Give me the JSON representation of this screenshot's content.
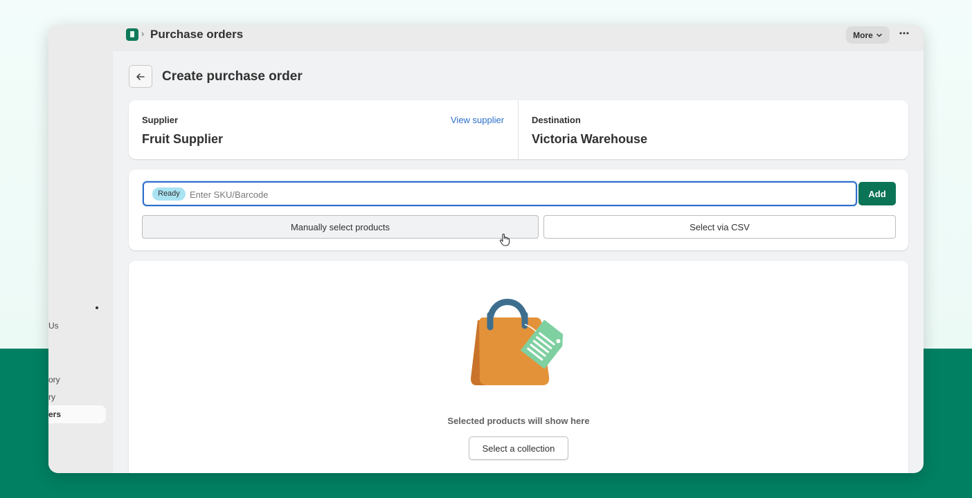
{
  "topbar": {
    "breadcrumb_separator": "›",
    "title": "Purchase orders",
    "more_label": "More",
    "more_chevron": "⌄",
    "overflow_glyph": "•••",
    "app_icon": "clipboard-icon"
  },
  "sidebar": {
    "items": [
      {
        "label": "Us"
      },
      {
        "label": "ory"
      },
      {
        "label": "ry"
      },
      {
        "label": "ers",
        "active": true
      }
    ]
  },
  "page": {
    "back_icon": "arrow-left-icon",
    "title": "Create purchase order"
  },
  "supplier": {
    "label": "Supplier",
    "name": "Fruit Supplier",
    "link": "View supplier"
  },
  "destination": {
    "label": "Destination",
    "name": "Victoria Warehouse"
  },
  "scanner": {
    "badge": "Ready",
    "placeholder": "Enter SKU/Barcode",
    "value": "",
    "add_label": "Add",
    "manual_label": "Manually select products",
    "csv_label": "Select via CSV"
  },
  "empty_state": {
    "illustration": "shopping-bag-icon",
    "message": "Selected products will show here",
    "button_label": "Select a collection"
  },
  "colors": {
    "brand_green": "#0b7356",
    "background_green": "#018062",
    "link_blue": "#2c6ecb",
    "badge_blue": "#a9e3f2",
    "bag_orange": "#e3923a",
    "tag_green": "#7fd0a0",
    "handle_blue": "#3e6e8e"
  }
}
